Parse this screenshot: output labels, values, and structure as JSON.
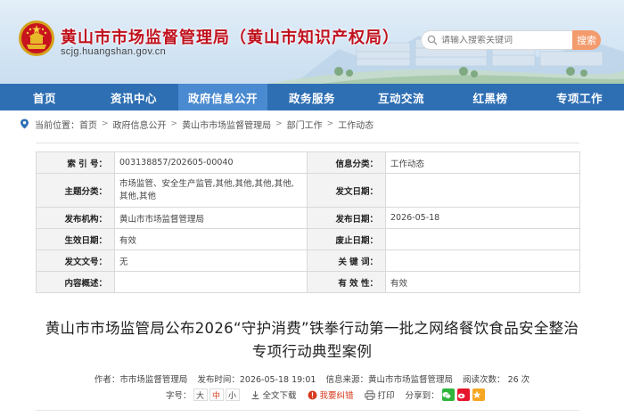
{
  "header": {
    "site_title": "黄山市市场监督管理局（黄山市知识产权局）",
    "site_domain": "scjg.huangshan.gov.cn",
    "search_placeholder": "请输入搜索关键词",
    "search_button": "搜索"
  },
  "nav": {
    "items": [
      {
        "label": "首页",
        "active": false
      },
      {
        "label": "资讯中心",
        "active": false
      },
      {
        "label": "政府信息公开",
        "active": true
      },
      {
        "label": "政务服务",
        "active": false
      },
      {
        "label": "互动交流",
        "active": false
      },
      {
        "label": "红黑榜",
        "active": false
      },
      {
        "label": "专项工作",
        "active": false
      }
    ]
  },
  "breadcrumb": {
    "prefix": "当前位置：",
    "items": [
      "首页",
      "政府信息公开",
      "黄山市市场监督管理局",
      "部门工作",
      "工作动态"
    ]
  },
  "info": {
    "index_label": "索 引 号：",
    "index_value": "003138857/202605-00040",
    "category_label": "信息分类：",
    "category_value": "工作动态",
    "topic_label": "主题分类：",
    "topic_value": "市场监管、安全生产监管,其他,其他,其他,其他,其他,其他",
    "doc_date_label": "发文日期：",
    "doc_date_value": "",
    "issuer_label": "发布机构：",
    "issuer_value": "黄山市市场监督管理局",
    "publish_date_label": "发布日期：",
    "publish_date_value": "2026-05-18",
    "effective_label": "生效日期：",
    "effective_value": "有效",
    "abolish_label": "废止日期：",
    "abolish_value": "",
    "doc_no_label": "发文文号：",
    "doc_no_value": "无",
    "keywords_label": "关 键 词：",
    "keywords_value": "",
    "summary_label": "内容概述：",
    "summary_value": "",
    "validity_label": "有 效 性：",
    "validity_value": "有效"
  },
  "article": {
    "title_line1": "黄山市市场监管局公布2026“守护消费”铁拳行动第一批之网络餐饮食品安全整治",
    "title_line2": "专项行动典型案例",
    "author": "作者：市市场监督管理局",
    "publish_time": "发布时间：2026-05-18 19:01",
    "source": "信息来源：黄山市市场监督管理局",
    "views": "阅读次数： 26 次",
    "font_size_label": "字号：",
    "font_large": "大",
    "font_medium": "中",
    "font_small": "小",
    "download": "全文下载",
    "error_report": "我要纠错",
    "print": "打印",
    "share": "分享到："
  },
  "colors": {
    "nav_bg": "#2e6fb4",
    "nav_active": "#4a8ad0",
    "title_red": "#c0121e",
    "search_btn": "#f39b6d",
    "accent_red": "#d63b1f"
  }
}
